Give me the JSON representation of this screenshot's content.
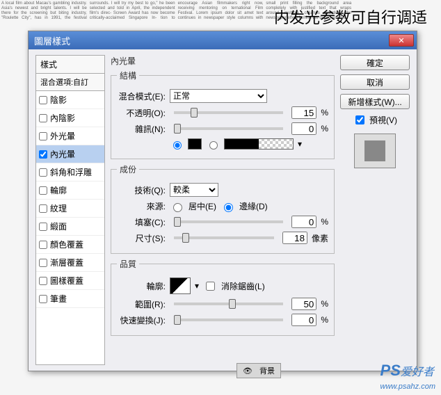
{
  "overlay_hint": "内发光参数可自行调适",
  "dialog": {
    "title": "圖層樣式",
    "close": "✕",
    "left": {
      "head": "樣式",
      "sub": "混合選項:自訂",
      "items": [
        {
          "label": "陰影",
          "checked": false,
          "selected": false
        },
        {
          "label": "內陰影",
          "checked": false,
          "selected": false
        },
        {
          "label": "外光暈",
          "checked": false,
          "selected": false
        },
        {
          "label": "內光暈",
          "checked": true,
          "selected": true
        },
        {
          "label": "斜角和浮雕",
          "checked": false,
          "selected": false
        },
        {
          "label": "輪廓",
          "checked": false,
          "selected": false
        },
        {
          "label": "紋理",
          "checked": false,
          "selected": false
        },
        {
          "label": "緞面",
          "checked": false,
          "selected": false
        },
        {
          "label": "顏色覆蓋",
          "checked": false,
          "selected": false
        },
        {
          "label": "漸層覆蓋",
          "checked": false,
          "selected": false
        },
        {
          "label": "圖樣覆蓋",
          "checked": false,
          "selected": false
        },
        {
          "label": "筆畫",
          "checked": false,
          "selected": false
        }
      ]
    },
    "center": {
      "title": "內光暈",
      "structure": {
        "legend": "結構",
        "blend_label": "混合模式(E):",
        "blend_value": "正常",
        "opacity_label": "不透明(O):",
        "opacity_value": "15",
        "pct": "%",
        "noise_label": "雜訊(N):",
        "noise_value": "0"
      },
      "elements": {
        "legend": "成份",
        "tech_label": "技術(Q):",
        "tech_value": "較柔",
        "source_label": "來源:",
        "center_opt": "居中(E)",
        "edge_opt": "邊緣(D)",
        "choke_label": "填塞(C):",
        "choke_value": "0",
        "size_label": "尺寸(S):",
        "size_value": "18",
        "px": "像素"
      },
      "quality": {
        "legend": "品質",
        "contour_label": "輪廓:",
        "antialias": "消除鋸齒(L)",
        "range_label": "範圍(R):",
        "range_value": "50",
        "jitter_label": "快速變換(J):",
        "jitter_value": "0"
      }
    },
    "right": {
      "ok": "確定",
      "cancel": "取消",
      "new_style": "新增樣式(W)...",
      "preview": "預視(V)"
    }
  },
  "bottom": {
    "label": "背景"
  },
  "watermark": {
    "ps": "PS",
    "text": "爱好者",
    "url": "www.psahz.com"
  }
}
